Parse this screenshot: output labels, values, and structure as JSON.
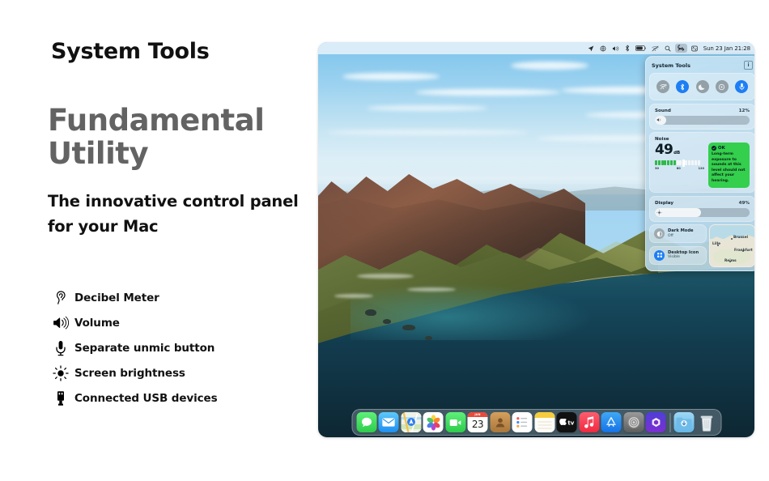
{
  "marketing": {
    "kicker": "System Tools",
    "headline": "Fundamental Utility",
    "subhead": "The innovative control panel for your Mac",
    "features": [
      {
        "icon": "ear-icon",
        "label": "Decibel Meter"
      },
      {
        "icon": "speaker-waves-icon",
        "label": "Volume"
      },
      {
        "icon": "microphone-icon",
        "label": "Separate unmic button"
      },
      {
        "icon": "brightness-sun-icon",
        "label": "Screen brightness"
      },
      {
        "icon": "usb-icon",
        "label": "Connected USB devices"
      }
    ]
  },
  "menubar": {
    "icons": [
      "location-arrow-icon",
      "display-icon",
      "volume-icon",
      "bluetooth-icon",
      "battery-icon",
      "wifi-icon",
      "search-icon",
      "system-tools-icon",
      "control-center-icon"
    ],
    "clock": "Sun 23 Jan  21:28"
  },
  "panel": {
    "title": "System Tools",
    "info_label": "i",
    "toggles": [
      {
        "name": "wifi-toggle",
        "icon": "wifi-icon",
        "state": "off"
      },
      {
        "name": "bluetooth-toggle",
        "icon": "bluetooth-icon",
        "state": "on"
      },
      {
        "name": "do-not-disturb-toggle",
        "icon": "moon-icon",
        "state": "off"
      },
      {
        "name": "airdrop-toggle",
        "icon": "airdrop-icon",
        "state": "off"
      },
      {
        "name": "microphone-toggle",
        "icon": "microphone-icon",
        "state": "on"
      }
    ],
    "sound": {
      "label": "Sound",
      "value": "12%",
      "percent": 12
    },
    "noise": {
      "label": "Noise",
      "value": "49",
      "unit": "dB",
      "scale": [
        "30",
        "80",
        "120"
      ],
      "status_title": "OK",
      "status_body": "Long-term exposure to sounds at this level should not affect your hearing.",
      "status_color": "#33cf4d",
      "segments_green": 7,
      "segments_total": 15,
      "needle_index": 9
    },
    "display": {
      "label": "Display",
      "value": "49%",
      "percent": 49
    },
    "tiles": [
      {
        "name": "dark-mode-tile",
        "icon": "half-circle-icon",
        "title": "Dark Mode",
        "subtitle": "Off"
      },
      {
        "name": "desktop-icon-tile",
        "icon": "grid-icon",
        "title": "Desktop Icon",
        "subtitle": "Visible"
      }
    ],
    "map": {
      "labels": [
        "Brussel",
        "Frankfurt",
        "Lille",
        "Reims"
      ]
    }
  },
  "dock": {
    "apps": [
      {
        "name": "messages",
        "label": "Messages"
      },
      {
        "name": "mail",
        "label": "Mail"
      },
      {
        "name": "maps",
        "label": "Maps"
      },
      {
        "name": "photos",
        "label": "Photos"
      },
      {
        "name": "facetime",
        "label": "FaceTime"
      },
      {
        "name": "calendar",
        "label": "Calendar",
        "month": "JAN",
        "day": "23"
      },
      {
        "name": "contacts",
        "label": "Contacts"
      },
      {
        "name": "reminders",
        "label": "Reminders"
      },
      {
        "name": "notes",
        "label": "Notes"
      },
      {
        "name": "appletv",
        "label": "Apple TV"
      },
      {
        "name": "music",
        "label": "Music"
      },
      {
        "name": "appstore",
        "label": "App Store"
      },
      {
        "name": "settings",
        "label": "System Settings"
      },
      {
        "name": "shortcuts",
        "label": "Shortcuts"
      }
    ],
    "extras": [
      {
        "name": "downloads",
        "label": "Downloads"
      },
      {
        "name": "trash",
        "label": "Trash"
      }
    ]
  },
  "colors": {
    "accent_blue": "#1d7ef5",
    "status_green": "#33cf4d",
    "headline_gray": "#636363"
  }
}
